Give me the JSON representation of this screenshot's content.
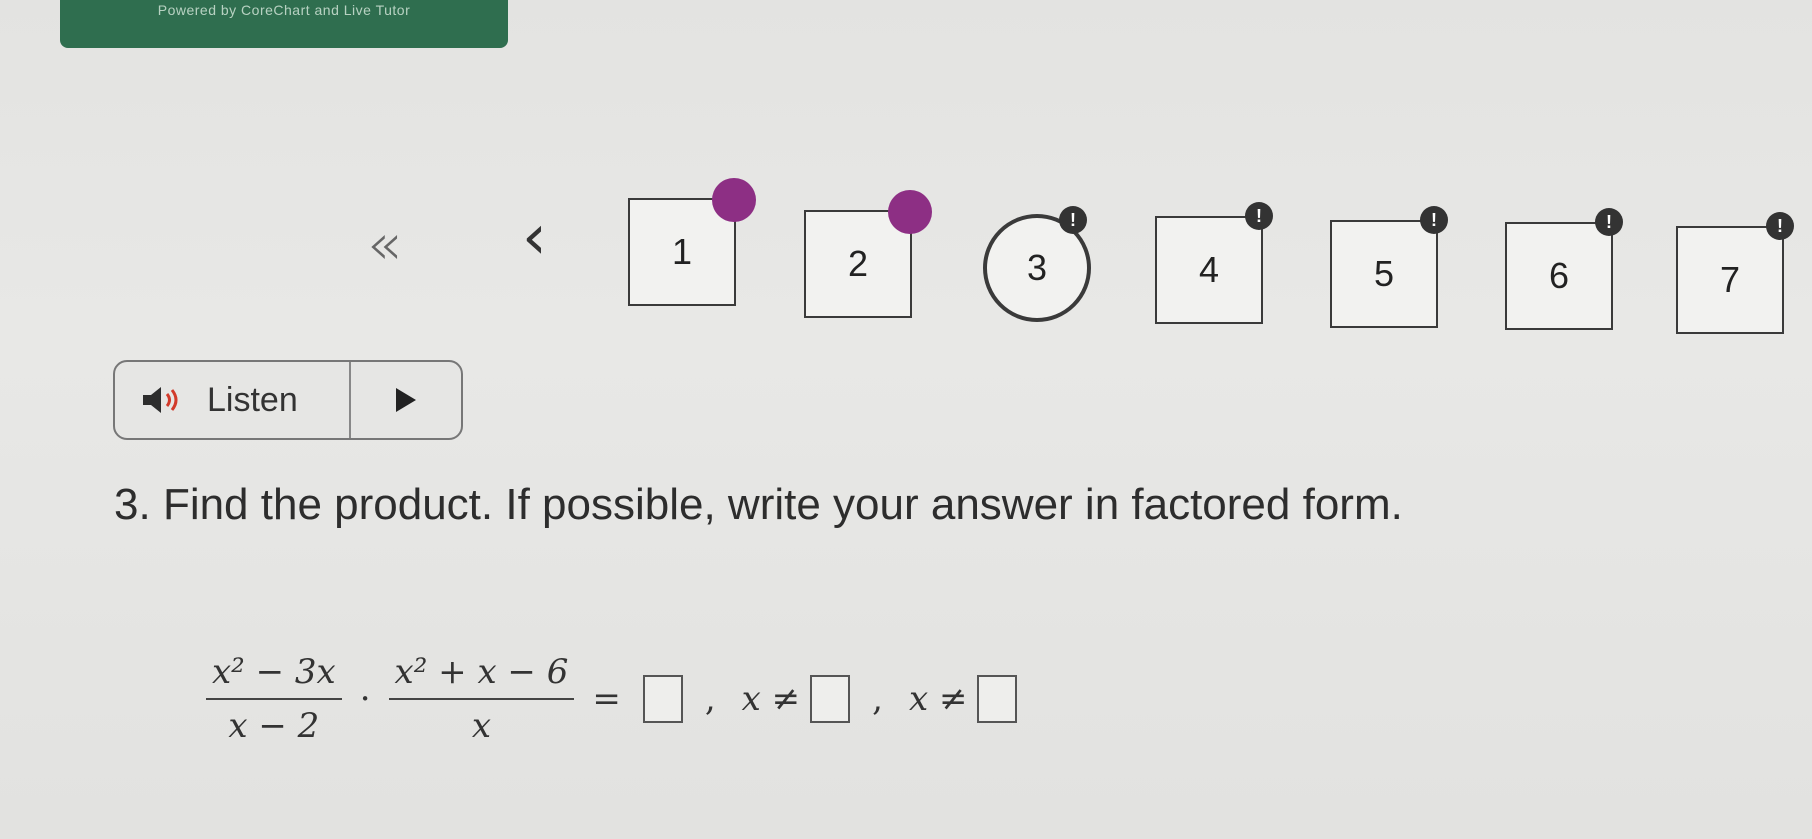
{
  "banner": {
    "text": "Powered by CoreChart and Live Tutor"
  },
  "nav": {
    "questions": [
      {
        "label": "1",
        "status": "answered"
      },
      {
        "label": "2",
        "status": "answered"
      },
      {
        "label": "3",
        "status": "current"
      },
      {
        "label": "4",
        "status": "alert"
      },
      {
        "label": "5",
        "status": "alert"
      },
      {
        "label": "6",
        "status": "alert"
      },
      {
        "label": "7",
        "status": "alert"
      }
    ],
    "alert_mark": "!"
  },
  "listen": {
    "label": "Listen"
  },
  "question": {
    "number": "3.",
    "text": "Find the product. If possible, write your answer in factored form."
  },
  "math": {
    "frac1_num": "x² − 3x",
    "frac1_den": "x − 2",
    "dot": "·",
    "frac2_num": "x² + x − 6",
    "frac2_den": "x",
    "equals": "=",
    "comma": ",",
    "restriction_prefix": "x ≠"
  },
  "colors": {
    "answered_dot": "#8d2f84",
    "banner": "#2f6e4f"
  }
}
